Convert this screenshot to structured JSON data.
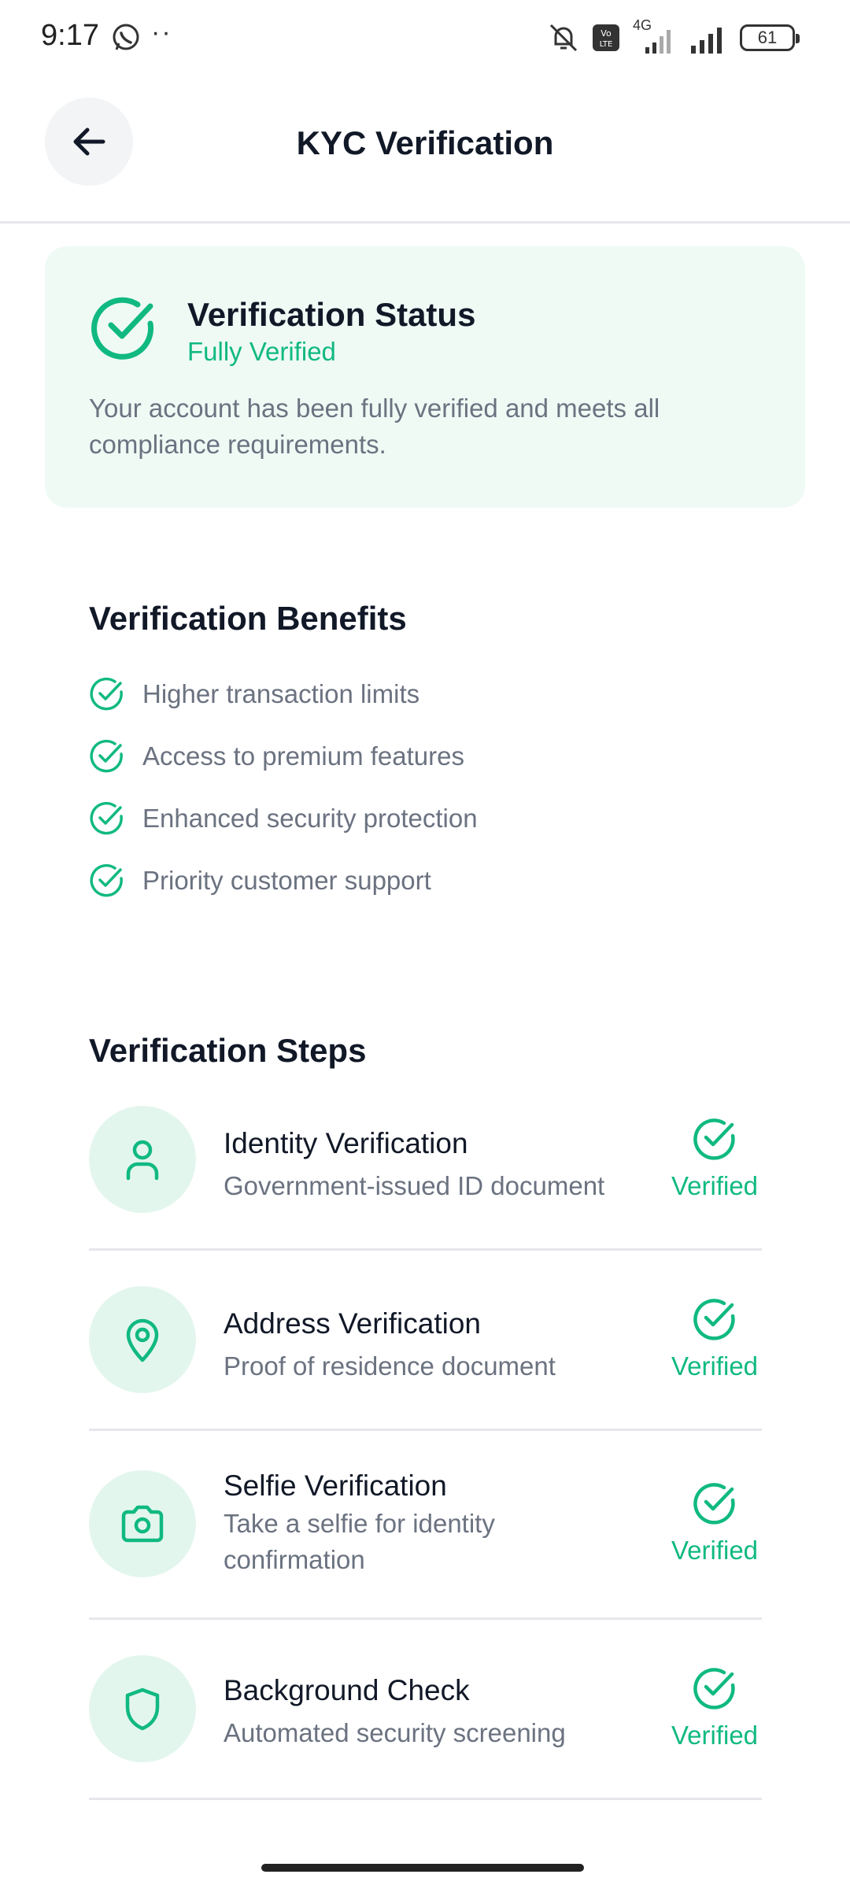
{
  "status_bar": {
    "time": "9:17",
    "dots": "··",
    "battery": "61",
    "network": "4G",
    "icons": [
      "whatsapp-icon",
      "mute-icon",
      "volte-icon",
      "signal-icon",
      "battery-icon"
    ]
  },
  "header": {
    "title": "KYC Verification",
    "back_icon": "arrow-left-icon"
  },
  "status_card": {
    "title": "Verification Status",
    "subtitle": "Fully Verified",
    "description": "Your account has been fully verified and meets all compliance requirements."
  },
  "benefits": {
    "title": "Verification Benefits",
    "items": [
      {
        "label": "Higher transaction limits"
      },
      {
        "label": "Access to premium features"
      },
      {
        "label": "Enhanced security protection"
      },
      {
        "label": "Priority customer support"
      }
    ]
  },
  "steps": {
    "title": "Verification Steps",
    "items": [
      {
        "title": "Identity Verification",
        "description": "Government-issued ID document",
        "status": "Verified",
        "icon": "user-icon"
      },
      {
        "title": "Address Verification",
        "description": "Proof of residence document",
        "status": "Verified",
        "icon": "map-pin-icon"
      },
      {
        "title": "Selfie Verification",
        "description": "Take a selfie for identity confirmation",
        "status": "Verified",
        "icon": "camera-icon"
      },
      {
        "title": "Background Check",
        "description": "Automated security screening",
        "status": "Verified",
        "icon": "shield-icon"
      }
    ]
  },
  "colors": {
    "accent": "#10b981",
    "card_bg": "#effaf5",
    "icon_bg": "#e3f6ee",
    "text_primary": "#111827",
    "text_secondary": "#6b7280"
  }
}
